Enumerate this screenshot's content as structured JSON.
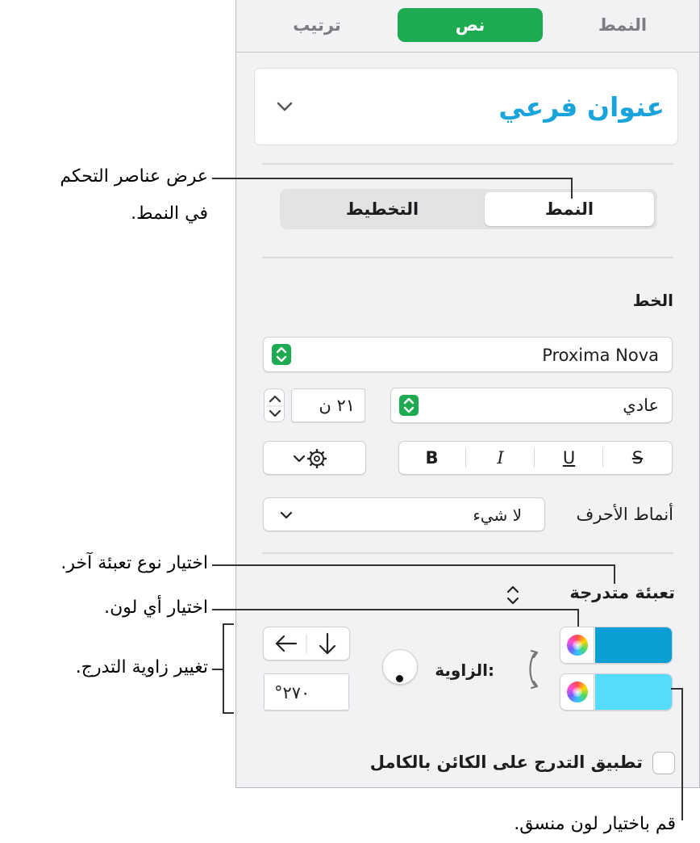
{
  "tabs": [
    {
      "label": "النمط",
      "active": false
    },
    {
      "label": "نص",
      "active": true
    },
    {
      "label": "ترتيب",
      "active": false
    }
  ],
  "paragraph_style": {
    "name": "عنوان فرعي",
    "color": "#1aa4dc"
  },
  "segmented": {
    "style_label": "النمط",
    "layout_label": "التخطيط"
  },
  "font": {
    "section_label": "الخط",
    "family": "Proxima Nova",
    "typeface": "عادي",
    "size": "٢١ ن",
    "bold": "B",
    "italic": "I",
    "underline": "U",
    "strike": "S"
  },
  "character_styles": {
    "label": "أنماط الأحرف",
    "value": "لا شيء"
  },
  "fill": {
    "type_label": "تعبئة متدرجة",
    "color1": "#0b9fd6",
    "color2": "#56dcfb",
    "angle_label": "الزاوية:",
    "angle_value": "°٢٧٠"
  },
  "apply_checkbox": {
    "label": "تطبيق التدرج على الكائن بالكامل",
    "checked": false
  },
  "callouts": {
    "style_controls": [
      "عرض عناصر التحكم",
      "في النمط."
    ],
    "fill_type": "اختيار نوع تعبئة آخر.",
    "any_color": "اختيار أي لون.",
    "gradient_angle": "تغيير زاوية التدرج.",
    "matching_color": "قم باختيار لون منسق."
  },
  "icons": [
    "chevron-down-icon",
    "gear-icon",
    "stepper-icon",
    "arrow-left-icon",
    "arrow-down-icon",
    "swap-arrows-icon",
    "color-wheel-icon",
    "angle-wheel-icon",
    "checkbox-icon"
  ]
}
